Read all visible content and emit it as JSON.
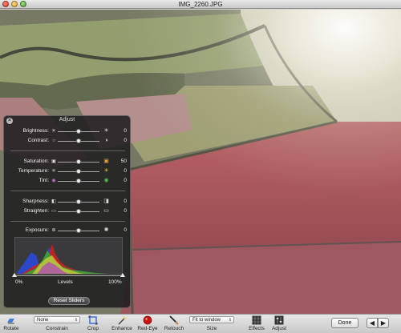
{
  "window": {
    "title": "IMG_2260.JPG"
  },
  "adjust": {
    "title": "Adjust",
    "sliders": [
      {
        "label": "Brightness:",
        "value": "0",
        "level": 0.5,
        "left_icon": "sun-small-icon",
        "right_icon": "sun-large-icon"
      },
      {
        "label": "Contrast:",
        "value": "0",
        "level": 0.5,
        "left_icon": "contrast-low-icon",
        "right_icon": "contrast-high-icon"
      },
      {
        "label": "Saturation:",
        "value": "50",
        "level": 0.5,
        "left_icon": "saturation-low-icon",
        "right_icon": "saturation-high-icon"
      },
      {
        "label": "Temperature:",
        "value": "0",
        "level": 0.5,
        "left_icon": "snowflake-icon",
        "right_icon": "sun-warm-icon"
      },
      {
        "label": "Tint:",
        "value": "0",
        "level": 0.5,
        "left_icon": "tint-magenta-icon",
        "right_icon": "tint-green-icon"
      },
      {
        "label": "Sharpness:",
        "value": "0",
        "level": 0.5,
        "left_icon": "sharpness-low-icon",
        "right_icon": "sharpness-high-icon"
      },
      {
        "label": "Straighten:",
        "value": "0",
        "level": 0.5,
        "left_icon": "straighten-left-icon",
        "right_icon": "straighten-right-icon"
      },
      {
        "label": "Exposure:",
        "value": "0",
        "level": 0.5,
        "left_icon": "aperture-small-icon",
        "right_icon": "aperture-large-icon"
      }
    ],
    "levels": {
      "min_label": "0%",
      "caption": "Levels",
      "max_label": "100%",
      "black_point": 0.0,
      "white_point": 1.0
    },
    "reset_label": "Reset Sliders"
  },
  "toolbar": {
    "rotate_label": "Rotate",
    "constrain_value": "None",
    "constrain_label": "Constrain",
    "crop_label": "Crop",
    "enhance_label": "Enhance",
    "redeye_label": "Red-Eye",
    "retouch_label": "Retouch",
    "size_value": "Fit to window",
    "size_label": "Size",
    "effects_label": "Effects",
    "adjust_label": "Adjust",
    "done_label": "Done"
  },
  "colors": {
    "redeye": "#cc1111",
    "crop_accent": "#3a6fd8",
    "rotate_accent": "#3a7fd8"
  }
}
